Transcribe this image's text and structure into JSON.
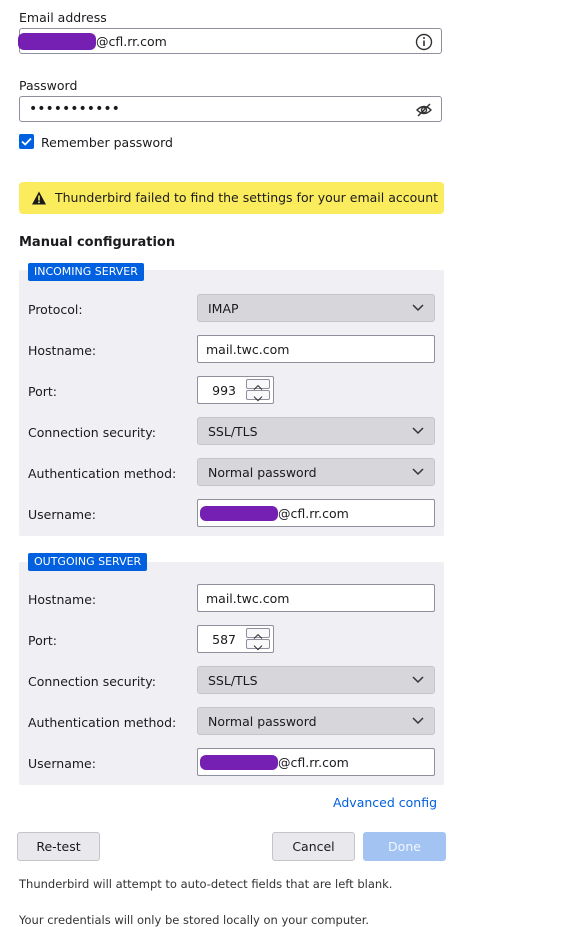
{
  "email": {
    "label": "Email address",
    "value_suffix": "@cfl.rr.com",
    "info_icon": "info-icon"
  },
  "password": {
    "label": "Password",
    "masked_value": "•••••••••••",
    "toggle_icon": "eye-slash-icon"
  },
  "remember": {
    "label": "Remember password",
    "checked": true
  },
  "warning": {
    "text": "Thunderbird failed to find the settings for your email account",
    "icon": "warning-icon",
    "color": "#fbec5d"
  },
  "manual": {
    "title": "Manual configuration"
  },
  "incoming": {
    "badge": "INCOMING SERVER",
    "protocol_label": "Protocol:",
    "protocol_value": "IMAP",
    "hostname_label": "Hostname:",
    "hostname_value": "mail.twc.com",
    "port_label": "Port:",
    "port_value": "993",
    "security_label": "Connection security:",
    "security_value": "SSL/TLS",
    "auth_label": "Authentication method:",
    "auth_value": "Normal password",
    "username_label": "Username:",
    "username_suffix": "@cfl.rr.com"
  },
  "outgoing": {
    "badge": "OUTGOING SERVER",
    "hostname_label": "Hostname:",
    "hostname_value": "mail.twc.com",
    "port_label": "Port:",
    "port_value": "587",
    "security_label": "Connection security:",
    "security_value": "SSL/TLS",
    "auth_label": "Authentication method:",
    "auth_value": "Normal password",
    "username_label": "Username:",
    "username_suffix": "@cfl.rr.com"
  },
  "advanced_link": "Advanced config",
  "buttons": {
    "retest": "Re-test",
    "cancel": "Cancel",
    "done": "Done"
  },
  "notes": {
    "autodetect": "Thunderbird will attempt to auto-detect fields that are left blank.",
    "credentials": "Your credentials will only be stored locally on your computer."
  },
  "colors": {
    "accent": "#0060df",
    "redaction": "#6a0dad",
    "done_disabled": "#a3c4f3"
  }
}
